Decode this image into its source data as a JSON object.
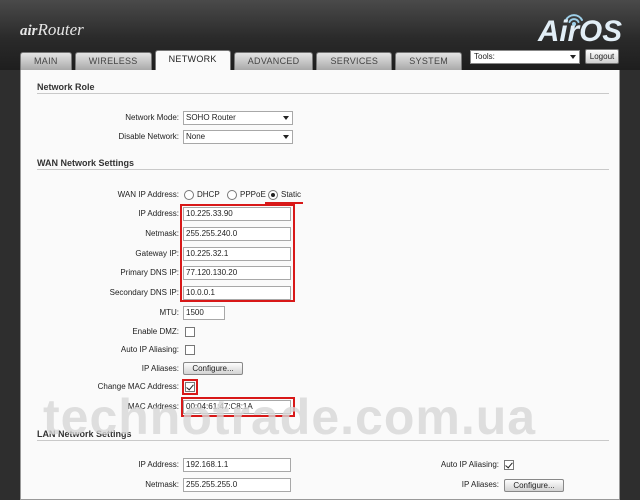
{
  "brand": {
    "prefix": "air",
    "name": "Router"
  },
  "logo": {
    "text": "AirOS"
  },
  "tabs": [
    {
      "label": "MAIN"
    },
    {
      "label": "WIRELESS"
    },
    {
      "label": "NETWORK"
    },
    {
      "label": "ADVANCED"
    },
    {
      "label": "SERVICES"
    },
    {
      "label": "SYSTEM"
    }
  ],
  "tools": {
    "label": "Tools:",
    "logout": "Logout"
  },
  "network_role": {
    "heading": "Network Role",
    "mode_label": "Network Mode:",
    "mode_value": "SOHO Router",
    "disable_label": "Disable Network:",
    "disable_value": "None"
  },
  "wan": {
    "heading": "WAN Network Settings",
    "ip_mode_label": "WAN IP Address:",
    "opt_dhcp": "DHCP",
    "opt_pppoe": "PPPoE",
    "opt_static": "Static",
    "selected": "Static",
    "ip_label": "IP Address:",
    "ip_value": "10.225.33.90",
    "netmask_label": "Netmask:",
    "netmask_value": "255.255.240.0",
    "gateway_label": "Gateway IP:",
    "gateway_value": "10.225.32.1",
    "dns1_label": "Primary DNS IP:",
    "dns1_value": "77.120.130.20",
    "dns2_label": "Secondary DNS IP:",
    "dns2_value": "10.0.0.1",
    "mtu_label": "MTU:",
    "mtu_value": "1500",
    "dmz_label": "Enable DMZ:",
    "dmz_checked": false,
    "alias_label": "Auto IP Aliasing:",
    "alias_checked": false,
    "aliases_label": "IP Aliases:",
    "configure": "Configure...",
    "change_mac_label": "Change MAC Address:",
    "change_mac_checked": true,
    "mac_label": "MAC Address:",
    "mac_value": "00:04:61:47:C8:1A"
  },
  "lan": {
    "heading": "LAN Network Settings",
    "ip_label": "IP Address:",
    "ip_value": "192.168.1.1",
    "netmask_label": "Netmask:",
    "netmask_value": "255.255.255.0",
    "alias_label": "Auto IP Aliasing:",
    "alias_checked": true,
    "aliases_label": "IP Aliases:",
    "configure": "Configure..."
  },
  "watermark": "technotrade.com.ua",
  "colors": {
    "highlight": "#d81818",
    "header_bg": "#2e2e2e",
    "panel_bg": "#fafafa"
  }
}
